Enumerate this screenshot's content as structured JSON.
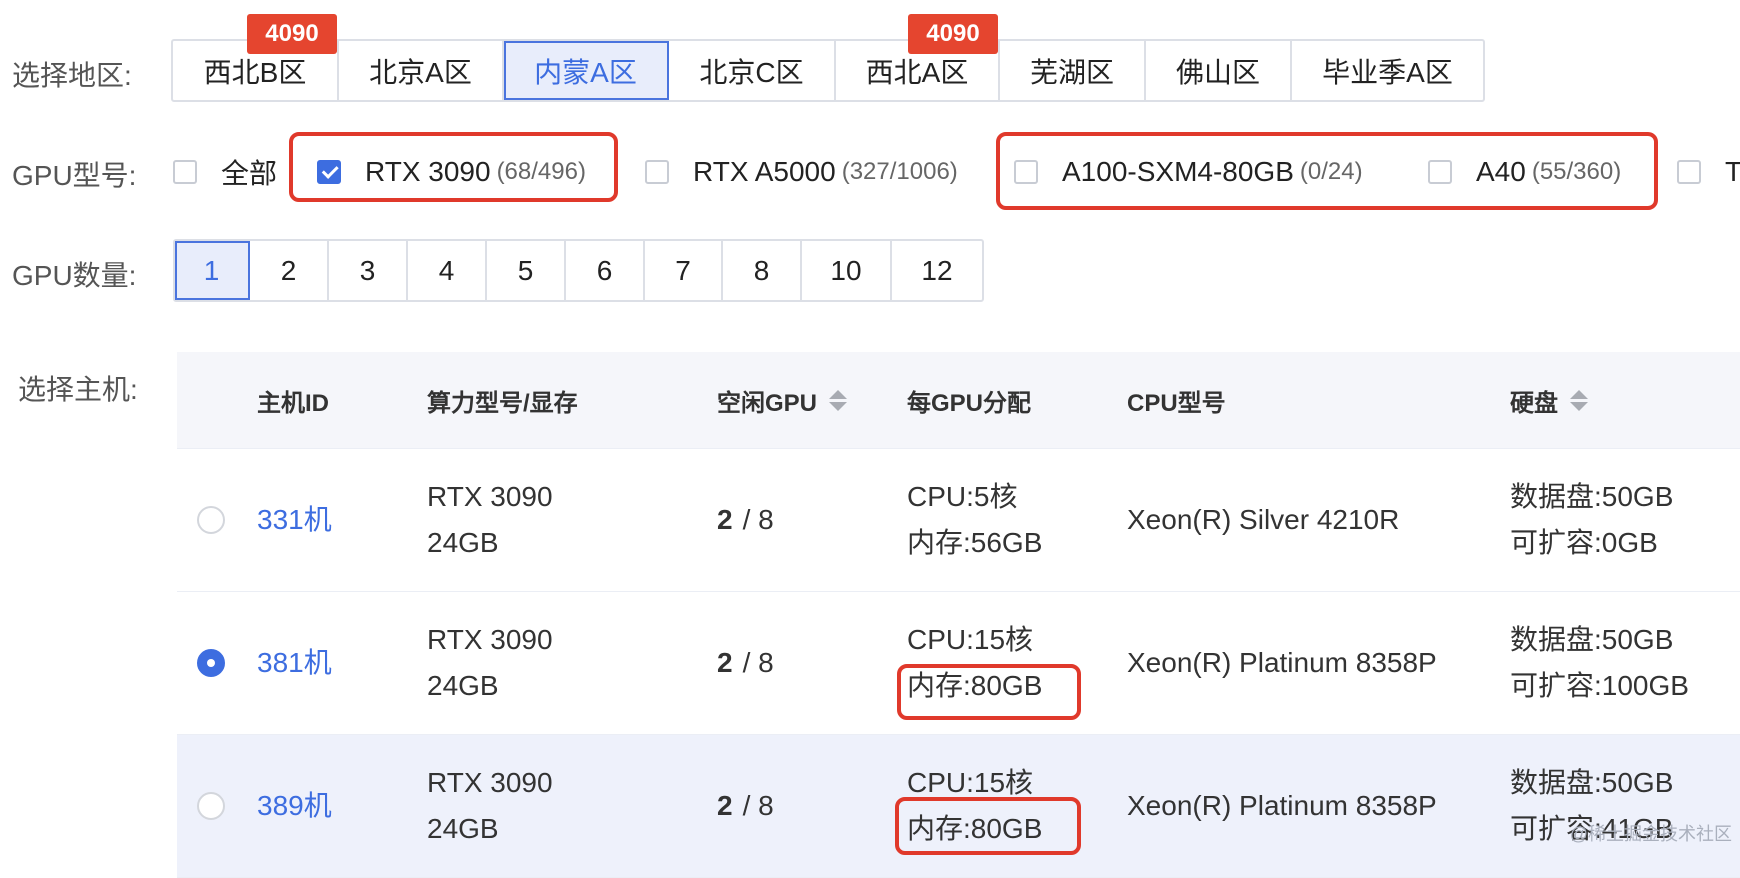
{
  "region": {
    "label": "选择地区:",
    "tabs": [
      {
        "label": "西北B区",
        "badge": "4090"
      },
      {
        "label": "北京A区"
      },
      {
        "label": "内蒙A区",
        "active": true
      },
      {
        "label": "北京C区"
      },
      {
        "label": "西北A区",
        "badge": "4090"
      },
      {
        "label": "芜湖区"
      },
      {
        "label": "佛山区"
      },
      {
        "label": "毕业季A区"
      }
    ]
  },
  "gpu_type": {
    "label": "GPU型号:",
    "options": [
      {
        "name": "全部",
        "count": "",
        "checked": false
      },
      {
        "name": "RTX 3090",
        "count": "(68/496)",
        "checked": true
      },
      {
        "name": "RTX A5000",
        "count": "(327/1006)",
        "checked": false
      },
      {
        "name": "A100-SXM4-80GB",
        "count": "(0/24)",
        "checked": false
      },
      {
        "name": "A40",
        "count": "(55/360)",
        "checked": false
      },
      {
        "name": "T",
        "count": "",
        "checked": false
      }
    ]
  },
  "gpu_qty": {
    "label": "GPU数量:",
    "options": [
      "1",
      "2",
      "3",
      "4",
      "5",
      "6",
      "7",
      "8",
      "10",
      "12"
    ],
    "selected": "1"
  },
  "hosts": {
    "label": "选择主机:",
    "columns": {
      "id": "主机ID",
      "model": "算力型号/显存",
      "free_gpu": "空闲GPU",
      "per_gpu": "每GPU分配",
      "cpu_model": "CPU型号",
      "disk": "硬盘"
    },
    "rows": [
      {
        "id": "331机",
        "model": "RTX 3090",
        "vram": "24GB",
        "free": "2",
        "total": "/ 8",
        "cpu": "CPU:5核",
        "mem": "内存:56GB",
        "cpu_model": "Xeon(R) Silver 4210R",
        "disk": "数据盘:50GB",
        "expand": "可扩容:0GB",
        "selected": false
      },
      {
        "id": "381机",
        "model": "RTX 3090",
        "vram": "24GB",
        "free": "2",
        "total": "/ 8",
        "cpu": "CPU:15核",
        "mem": "内存:80GB",
        "cpu_model": "Xeon(R) Platinum 8358P",
        "disk": "数据盘:50GB",
        "expand": "可扩容:100GB",
        "selected": true
      },
      {
        "id": "389机",
        "model": "RTX 3090",
        "vram": "24GB",
        "free": "2",
        "total": "/ 8",
        "cpu": "CPU:15核",
        "mem": "内存:80GB",
        "cpu_model": "Xeon(R) Platinum 8358P",
        "disk": "数据盘:50GB",
        "expand": "可扩容:41GB",
        "selected": false
      }
    ]
  },
  "watermark": "@稀土掘金技术社区",
  "colors": {
    "accent": "#3d6de0",
    "badge": "#e5452f",
    "annotation": "#e0392b"
  }
}
